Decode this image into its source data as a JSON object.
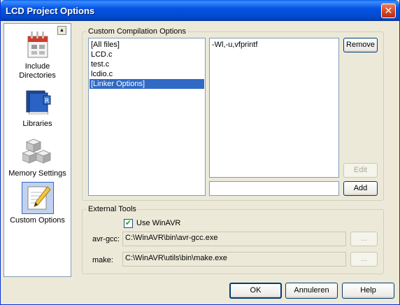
{
  "window": {
    "title": "LCD Project Options",
    "close_glyph": "✕"
  },
  "sidebar": {
    "scroll_glyph": "▲",
    "items": [
      {
        "label_line1": "Include",
        "label_line2": "Directories",
        "icon": "include-directories-icon"
      },
      {
        "label_line1": "Libraries",
        "icon": "libraries-icon"
      },
      {
        "label_line1": "Memory Settings",
        "icon": "memory-settings-icon"
      },
      {
        "label_line1": "Custom Options",
        "icon": "custom-options-icon",
        "selected": true
      }
    ]
  },
  "compilation": {
    "group_label": "Custom Compilation Options",
    "files": [
      "[All files]",
      "LCD.c",
      "test.c",
      "lcdio.c",
      "[Linker Options]"
    ],
    "selected_file_index": 4,
    "options": [
      "-Wl,-u,vfprintf"
    ],
    "remove_label": "Remove",
    "edit_label": "Edit",
    "add_label": "Add",
    "new_option_value": ""
  },
  "external_tools": {
    "group_label": "External Tools",
    "use_winavr_label": "Use WinAVR",
    "use_winavr_checked": true,
    "check_glyph": "✔",
    "avr_gcc_label": "avr-gcc:",
    "avr_gcc_path": "C:\\WinAVR\\bin\\avr-gcc.exe",
    "make_label": "make:",
    "make_path": "C:\\WinAVR\\utils\\bin\\make.exe",
    "browse_label": "..."
  },
  "footer": {
    "ok_label": "OK",
    "cancel_label": "Annuleren",
    "help_label": "Help"
  },
  "colors": {
    "selection": "#316ac5",
    "titlebar": "#0554e3",
    "dialog_bg": "#ece9d8"
  }
}
